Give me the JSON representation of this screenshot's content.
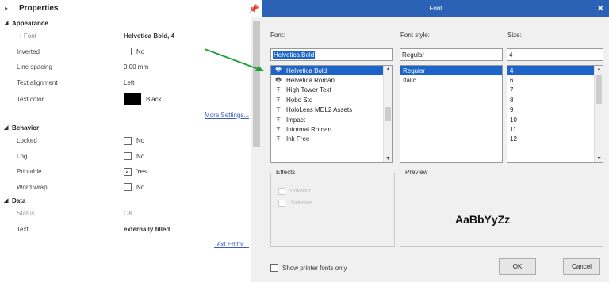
{
  "properties": {
    "title": "Properties",
    "sections": {
      "appearance": {
        "label": "Appearance",
        "font": {
          "label": "Font",
          "value": "Helvetica Bold, 4"
        },
        "inverted": {
          "label": "Inverted",
          "value": "No"
        },
        "line_spacing": {
          "label": "Line spacing",
          "value": "0.00 mm"
        },
        "text_alignment": {
          "label": "Text alignment",
          "value": "Left"
        },
        "text_color": {
          "label": "Text color",
          "value": "Black",
          "swatch": "#000000"
        },
        "more_settings": "More Settings..."
      },
      "behavior": {
        "label": "Behavior",
        "locked": {
          "label": "Locked",
          "value": "No"
        },
        "log": {
          "label": "Log",
          "value": "No"
        },
        "printable": {
          "label": "Printable",
          "value": "Yes"
        },
        "word_wrap": {
          "label": "Word wrap",
          "value": "No"
        }
      },
      "data": {
        "label": "Data",
        "status": {
          "label": "Status",
          "value": "OK"
        },
        "text": {
          "label": "Text",
          "value": "externally filled"
        },
        "text_editor": "Text Editor..."
      }
    }
  },
  "font_dialog": {
    "title": "Font",
    "font_label": "Font:",
    "style_label": "Font style:",
    "size_label": "Size:",
    "font_input": "Helvetica Bold",
    "style_input": "Regular",
    "size_input": "4",
    "fonts": [
      {
        "name": "Helvetica Bold",
        "icon": "printer-icon"
      },
      {
        "name": "Helvetica Roman",
        "icon": "printer-icon"
      },
      {
        "name": "High Tower Text",
        "icon": "truetype-icon"
      },
      {
        "name": "Hobo Std",
        "icon": "truetype-icon"
      },
      {
        "name": "HoloLens MDL2 Assets",
        "icon": "truetype-icon"
      },
      {
        "name": "Impact",
        "icon": "truetype-icon"
      },
      {
        "name": "Informal Roman",
        "icon": "truetype-icon"
      },
      {
        "name": "Ink Free",
        "icon": "truetype-icon"
      }
    ],
    "styles": [
      "Regular",
      "Italic"
    ],
    "sizes": [
      "4",
      "6",
      "7",
      "8",
      "9",
      "10",
      "11",
      "12"
    ],
    "effects_label": "Effects",
    "strikeout": "Strikeout",
    "underline": "Underline",
    "preview_label": "Preview",
    "preview_text": "AaBbYyZz",
    "printer_fonts_only": "Show printer fonts only",
    "ok": "OK",
    "cancel": "Cancel"
  },
  "colors": {
    "accent": "#2b62b6",
    "selection": "#1c64c8",
    "arrow": "#1e9e3a",
    "link": "#3b5fc0"
  }
}
